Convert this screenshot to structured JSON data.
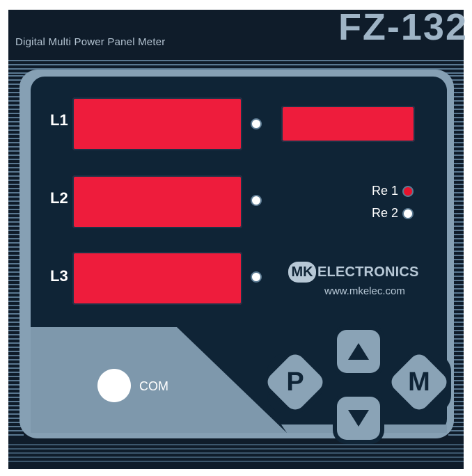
{
  "header": {
    "subtitle": "Digital Multi Power Panel Meter",
    "model": "FZ-132"
  },
  "rows": [
    {
      "label": "L1"
    },
    {
      "label": "L2"
    },
    {
      "label": "L3"
    }
  ],
  "relays": [
    {
      "label": "Re 1",
      "state": "on",
      "color": "#e8132d"
    },
    {
      "label": "Re 2",
      "state": "off",
      "color": "#ffffff"
    }
  ],
  "brand": {
    "badge": "MK",
    "name": "ELECTRONICS",
    "url": "www.mkelec.com"
  },
  "com": {
    "label": "COM"
  },
  "keys": {
    "p_label": "P",
    "m_label": "M",
    "up_icon": "up-arrow-icon",
    "down_icon": "down-arrow-icon"
  },
  "colors": {
    "display_red": "#ee1c3c",
    "panel_dark": "#0f2436",
    "frame_grey": "#86a0b4"
  }
}
